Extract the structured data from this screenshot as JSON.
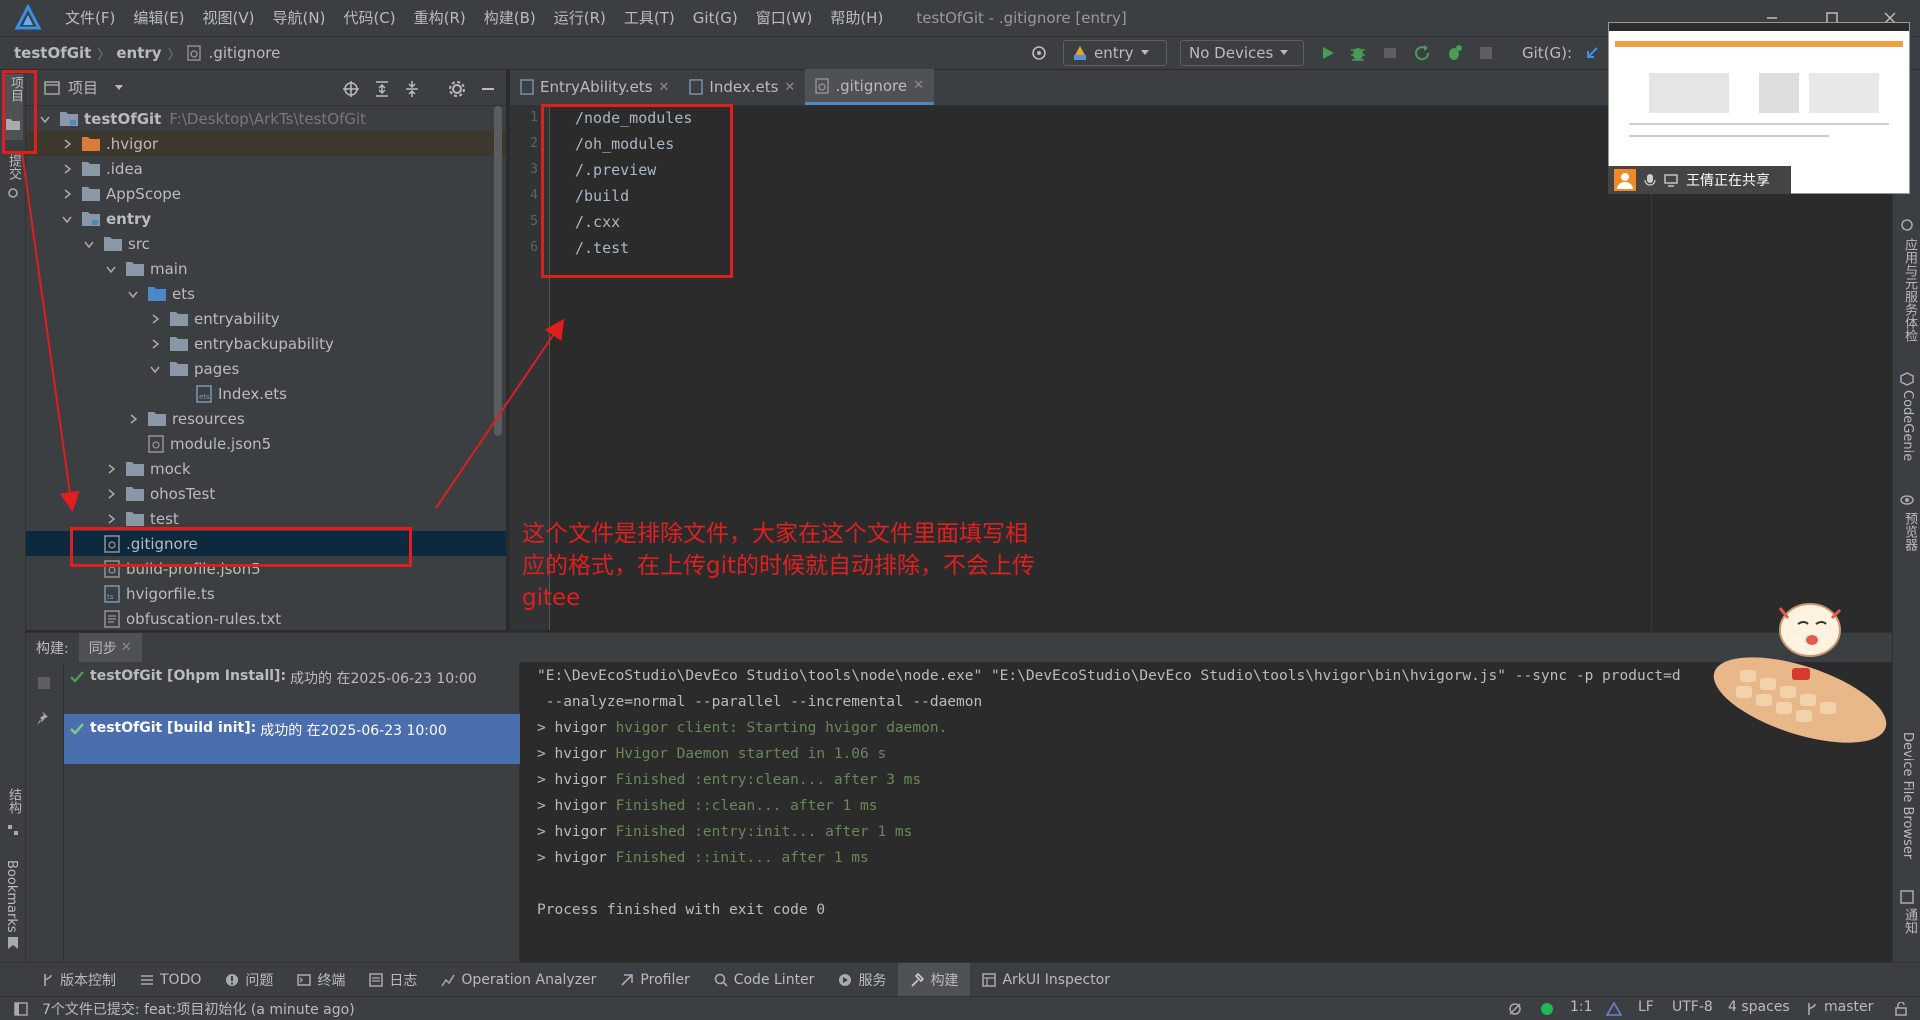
{
  "menu": [
    "文件(F)",
    "编辑(E)",
    "视图(V)",
    "导航(N)",
    "代码(C)",
    "重构(R)",
    "构建(B)",
    "运行(R)",
    "工具(T)",
    "Git(G)",
    "窗口(W)",
    "帮助(H)"
  ],
  "window_title": "testOfGit - .gitignore [entry]",
  "breadcrumb": {
    "project": "testOfGit",
    "module": "entry",
    "file": ".gitignore"
  },
  "toolbar": {
    "module_combo": "entry",
    "device_combo": "No Devices",
    "git_label": "Git(G):"
  },
  "left_strip": {
    "project": "项目",
    "commit": "提交",
    "structure": "结构",
    "bookmarks": "Bookmarks"
  },
  "project_panel": {
    "title": "项目"
  },
  "tree": {
    "root_name": "testOfGit",
    "root_path": "F:\\Desktop\\ArkTs\\testOfGit",
    "items": [
      ".hvigor",
      ".idea",
      "AppScope",
      "entry",
      "src",
      "main",
      "ets",
      "entryability",
      "entrybackupability",
      "pages",
      "Index.ets",
      "resources",
      "module.json5",
      "mock",
      "ohosTest",
      "test",
      ".gitignore",
      "build-profile.json5",
      "hvigorfile.ts",
      "obfuscation-rules.txt"
    ]
  },
  "editor": {
    "tabs": [
      "EntryAbility.ets",
      "Index.ets",
      ".gitignore"
    ],
    "line_numbers": [
      "1",
      "2",
      "3",
      "4",
      "5",
      "6"
    ],
    "lines": [
      "/node_modules",
      "/oh_modules",
      "/.preview",
      "/build",
      "/.cxx",
      "/.test"
    ]
  },
  "annotation": "这个文件是排除文件，大家在这个文件里面填写相应的格式，在上传git的时候就自动排除，不会上传gitee",
  "right_strip": {
    "app_services": "应用与元服务体检",
    "codegenie": "CodeGenie",
    "previewer": "预览器",
    "device_file_browser": "Device File Browser",
    "notifications": "通知"
  },
  "bottom": {
    "tabs": [
      "构建:",
      "同步"
    ],
    "builds": [
      {
        "name": "testOfGit [Ohpm Install]:",
        "status": "成功的 在2025-06-23 10:00"
      },
      {
        "name": "testOfGit [build init]:",
        "status": "成功的 在2025-06-23 10:00"
      }
    ],
    "console": [
      {
        "prefix": "\"E:\\DevEcoStudio\\DevEco Studio\\tools\\node\\node.exe\" \"E:\\DevEcoStudio\\DevEco Studio\\tools\\hvigor\\bin\\hvigorw.js\" --sync -p product=d",
        "msg": ""
      },
      {
        "prefix": " --analyze=normal --parallel --incremental --daemon",
        "msg": ""
      },
      {
        "prefix": "> hvigor ",
        "msg": "hvigor client: Starting hvigor daemon."
      },
      {
        "prefix": "> hvigor ",
        "msg": "Hvigor Daemon started in 1.06 s"
      },
      {
        "prefix": "> hvigor ",
        "msg": "Finished :entry:clean... after 3 ms"
      },
      {
        "prefix": "> hvigor ",
        "msg": "Finished ::clean... after 1 ms"
      },
      {
        "prefix": "> hvigor ",
        "msg": "Finished :entry:init... after 1 ms"
      },
      {
        "prefix": "> hvigor ",
        "msg": "Finished ::init... after 1 ms"
      },
      {
        "prefix": "",
        "msg": ""
      },
      {
        "prefix": "Process finished with exit code 0",
        "msg": ""
      }
    ]
  },
  "tool_windows": [
    "版本控制",
    "TODO",
    "问题",
    "终端",
    "日志",
    "Operation Analyzer",
    "Profiler",
    "Code Linter",
    "服务",
    "构建",
    "ArkUI Inspector"
  ],
  "status": {
    "message": "7个文件已提交: feat:项目初始化 (a minute ago)",
    "position": "1:1",
    "line_sep": "LF",
    "encoding": "UTF-8",
    "indent": "4 spaces",
    "branch": "master"
  },
  "share": {
    "label": "王倩正在共享"
  },
  "colors": {
    "annotation_red": "#e01e1e",
    "selection_blue": "#4b6eaf",
    "console_green": "#6a8759"
  }
}
